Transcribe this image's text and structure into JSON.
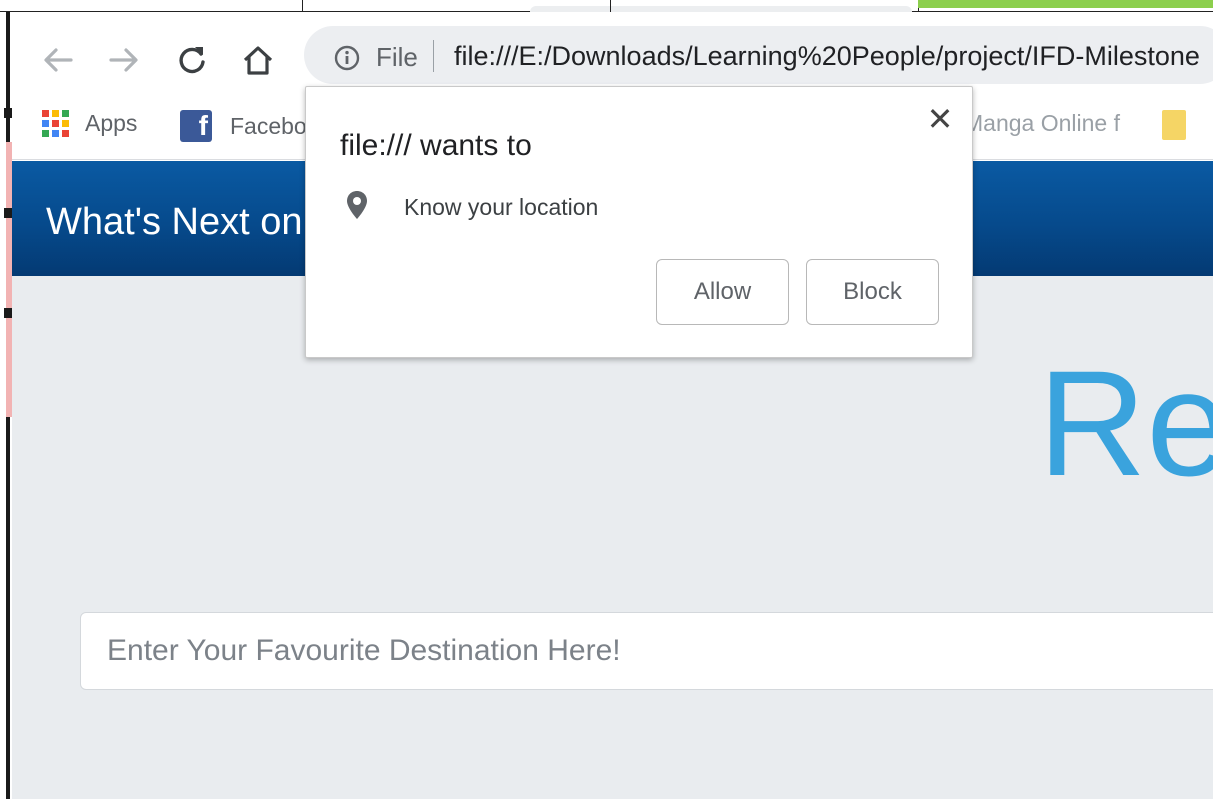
{
  "browser": {
    "address_bar": {
      "scheme_label": "File",
      "url": "file:///E:/Downloads/Learning%20People/project/IFD-Milestone"
    },
    "bookmarks": {
      "apps_label": "Apps",
      "facebook_label": "Facebook",
      "manga_label": "Manga Online f"
    }
  },
  "popup": {
    "title": "file:/// wants to",
    "permission": "Know your location",
    "allow_label": "Allow",
    "block_label": "Block",
    "close_symbol": "✕"
  },
  "page": {
    "header_title": "What's Next on Your Travel List?",
    "hero_text": "Ready",
    "search_placeholder": "Enter Your Favourite Destination Here!"
  },
  "icons": {
    "back": "back-arrow-icon",
    "forward": "forward-arrow-icon",
    "reload": "reload-icon",
    "home": "home-icon",
    "info": "info-icon",
    "apps": "apps-grid-icon",
    "facebook": "facebook-icon",
    "folder": "folder-icon",
    "location": "location-pin-icon",
    "close": "close-icon"
  },
  "colors": {
    "header_blue": "#064a8c",
    "hero_blue": "#3aa3dd",
    "page_bg": "#e9ecef",
    "omnibox_bg": "#eceef1",
    "facebook_blue": "#3b5998"
  }
}
